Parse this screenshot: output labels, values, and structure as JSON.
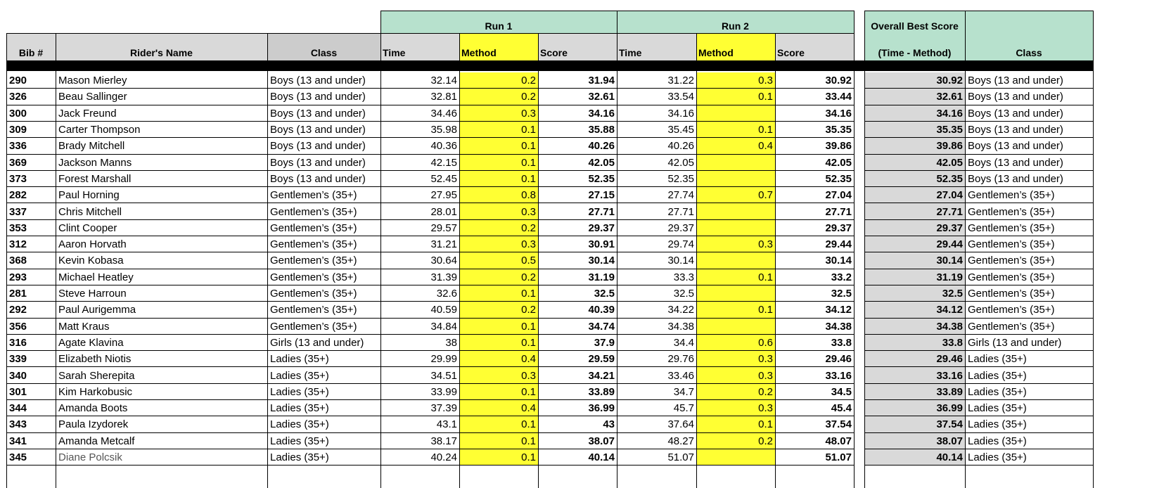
{
  "header": {
    "run1": "Run 1",
    "run2": "Run 2",
    "overall_line1": "Overall Best Score",
    "overall_line2": "(Time - Method)",
    "bib": "Bib #",
    "rider_name": "Rider's Name",
    "class": "Class",
    "time": "Time",
    "method": "Method",
    "score": "Score",
    "class2": "Class"
  },
  "rows": [
    {
      "bib": "290",
      "name": "Mason Mierley",
      "class": "Boys (13 and under)",
      "t1": "32.14",
      "m1": "0.2",
      "s1": "31.94",
      "t2": "31.22",
      "m2": "0.3",
      "s2": "30.92",
      "best": "30.92",
      "class2": "Boys (13 and under)"
    },
    {
      "bib": "326",
      "name": "Beau Sallinger",
      "class": "Boys (13 and under)",
      "t1": "32.81",
      "m1": "0.2",
      "s1": "32.61",
      "t2": "33.54",
      "m2": "0.1",
      "s2": "33.44",
      "best": "32.61",
      "class2": "Boys (13 and under)"
    },
    {
      "bib": "300",
      "name": "Jack Freund",
      "class": "Boys (13 and under)",
      "t1": "34.46",
      "m1": "0.3",
      "s1": "34.16",
      "t2": "34.16",
      "m2": "",
      "s2": "34.16",
      "best": "34.16",
      "class2": "Boys (13 and under)"
    },
    {
      "bib": "309",
      "name": "Carter Thompson",
      "class": "Boys (13 and under)",
      "t1": "35.98",
      "m1": "0.1",
      "s1": "35.88",
      "t2": "35.45",
      "m2": "0.1",
      "s2": "35.35",
      "best": "35.35",
      "class2": "Boys (13 and under)"
    },
    {
      "bib": "336",
      "name": "Brady Mitchell",
      "class": "Boys (13 and under)",
      "t1": "40.36",
      "m1": "0.1",
      "s1": "40.26",
      "t2": "40.26",
      "m2": "0.4",
      "s2": "39.86",
      "best": "39.86",
      "class2": "Boys (13 and under)"
    },
    {
      "bib": "369",
      "name": "Jackson Manns",
      "class": "Boys (13 and under)",
      "t1": "42.15",
      "m1": "0.1",
      "s1": "42.05",
      "t2": "42.05",
      "m2": "",
      "s2": "42.05",
      "best": "42.05",
      "class2": "Boys (13 and under)"
    },
    {
      "bib": "373",
      "name": "Forest Marshall",
      "class": "Boys (13 and under)",
      "t1": "52.45",
      "m1": "0.1",
      "s1": "52.35",
      "t2": "52.35",
      "m2": "",
      "s2": "52.35",
      "best": "52.35",
      "class2": "Boys (13 and under)"
    },
    {
      "bib": "282",
      "name": "Paul Horning",
      "class": "Gentlemen’s (35+)",
      "t1": "27.95",
      "m1": "0.8",
      "s1": "27.15",
      "t2": "27.74",
      "m2": "0.7",
      "s2": "27.04",
      "best": "27.04",
      "class2": "Gentlemen’s (35+)"
    },
    {
      "bib": "337",
      "name": "Chris Mitchell",
      "class": "Gentlemen’s (35+)",
      "t1": "28.01",
      "m1": "0.3",
      "s1": "27.71",
      "t2": "27.71",
      "m2": "",
      "s2": "27.71",
      "best": "27.71",
      "class2": "Gentlemen’s (35+)"
    },
    {
      "bib": "353",
      "name": "Clint Cooper",
      "class": "Gentlemen’s (35+)",
      "t1": "29.57",
      "m1": "0.2",
      "s1": "29.37",
      "t2": "29.37",
      "m2": "",
      "s2": "29.37",
      "best": "29.37",
      "class2": "Gentlemen’s (35+)"
    },
    {
      "bib": "312",
      "name": "Aaron Horvath",
      "class": "Gentlemen’s (35+)",
      "t1": "31.21",
      "m1": "0.3",
      "s1": "30.91",
      "t2": "29.74",
      "m2": "0.3",
      "s2": "29.44",
      "best": "29.44",
      "class2": "Gentlemen’s (35+)"
    },
    {
      "bib": "368",
      "name": "Kevin Kobasa",
      "class": "Gentlemen’s (35+)",
      "t1": "30.64",
      "m1": "0.5",
      "s1": "30.14",
      "t2": "30.14",
      "m2": "",
      "s2": "30.14",
      "best": "30.14",
      "class2": "Gentlemen’s (35+)"
    },
    {
      "bib": "293",
      "name": "Michael Heatley",
      "class": "Gentlemen’s (35+)",
      "t1": "31.39",
      "m1": "0.2",
      "s1": "31.19",
      "t2": "33.3",
      "m2": "0.1",
      "s2": "33.2",
      "best": "31.19",
      "class2": "Gentlemen’s (35+)"
    },
    {
      "bib": "281",
      "name": "Steve Harroun",
      "class": "Gentlemen’s (35+)",
      "t1": "32.6",
      "m1": "0.1",
      "s1": "32.5",
      "t2": "32.5",
      "m2": "",
      "s2": "32.5",
      "best": "32.5",
      "class2": "Gentlemen’s (35+)"
    },
    {
      "bib": "292",
      "name": "Paul Aurigemma",
      "class": "Gentlemen’s (35+)",
      "t1": "40.59",
      "m1": "0.2",
      "s1": "40.39",
      "t2": "34.22",
      "m2": "0.1",
      "s2": "34.12",
      "best": "34.12",
      "class2": "Gentlemen’s (35+)"
    },
    {
      "bib": "356",
      "name": "Matt Kraus",
      "class": "Gentlemen’s (35+)",
      "t1": "34.84",
      "m1": "0.1",
      "s1": "34.74",
      "t2": "34.38",
      "m2": "",
      "s2": "34.38",
      "best": "34.38",
      "class2": "Gentlemen’s (35+)"
    },
    {
      "bib": "316",
      "name": "Agate Klavina",
      "class": "Girls (13 and under)",
      "t1": "38",
      "m1": "0.1",
      "s1": "37.9",
      "t2": "34.4",
      "m2": "0.6",
      "s2": "33.8",
      "best": "33.8",
      "class2": "Girls (13 and under)"
    },
    {
      "bib": "339",
      "name": "Elizabeth Niotis",
      "class": "Ladies (35+)",
      "t1": "29.99",
      "m1": "0.4",
      "s1": "29.59",
      "t2": "29.76",
      "m2": "0.3",
      "s2": "29.46",
      "best": "29.46",
      "class2": "Ladies (35+)"
    },
    {
      "bib": "340",
      "name": "Sarah Sherepita",
      "class": "Ladies (35+)",
      "t1": "34.51",
      "m1": "0.3",
      "s1": "34.21",
      "t2": "33.46",
      "m2": "0.3",
      "s2": "33.16",
      "best": "33.16",
      "class2": "Ladies (35+)"
    },
    {
      "bib": "301",
      "name": "Kim Harkobusic",
      "class": "Ladies (35+)",
      "t1": "33.99",
      "m1": "0.1",
      "s1": "33.89",
      "t2": "34.7",
      "m2": "0.2",
      "s2": "34.5",
      "best": "33.89",
      "class2": "Ladies (35+)"
    },
    {
      "bib": "344",
      "name": "Amanda Boots",
      "class": "Ladies (35+)",
      "t1": "37.39",
      "m1": "0.4",
      "s1": "36.99",
      "t2": "45.7",
      "m2": "0.3",
      "s2": "45.4",
      "best": "36.99",
      "class2": "Ladies (35+)"
    },
    {
      "bib": "343",
      "name": "Paula Izydorek",
      "class": "Ladies (35+)",
      "t1": "43.1",
      "m1": "0.1",
      "s1": "43",
      "t2": "37.64",
      "m2": "0.1",
      "s2": "37.54",
      "best": "37.54",
      "class2": "Ladies (35+)"
    },
    {
      "bib": "341",
      "name": "Amanda Metcalf",
      "class": "Ladies (35+)",
      "t1": "38.17",
      "m1": "0.1",
      "s1": "38.07",
      "t2": "48.27",
      "m2": "0.2",
      "s2": "48.07",
      "best": "38.07",
      "class2": "Ladies (35+)"
    },
    {
      "bib": "345",
      "name": "Diane Polcsik",
      "class": "Ladies (35+)",
      "t1": "40.24",
      "m1": "0.1",
      "s1": "40.14",
      "t2": "51.07",
      "m2": "",
      "s2": "51.07",
      "best": "40.14",
      "class2": "Ladies (35+)"
    }
  ],
  "colors": {
    "header_green": "#b7e1cd",
    "header_grey": "#d9d9d9",
    "method_yellow": "#ffff33",
    "overall_grey": "#d9d9d9"
  }
}
